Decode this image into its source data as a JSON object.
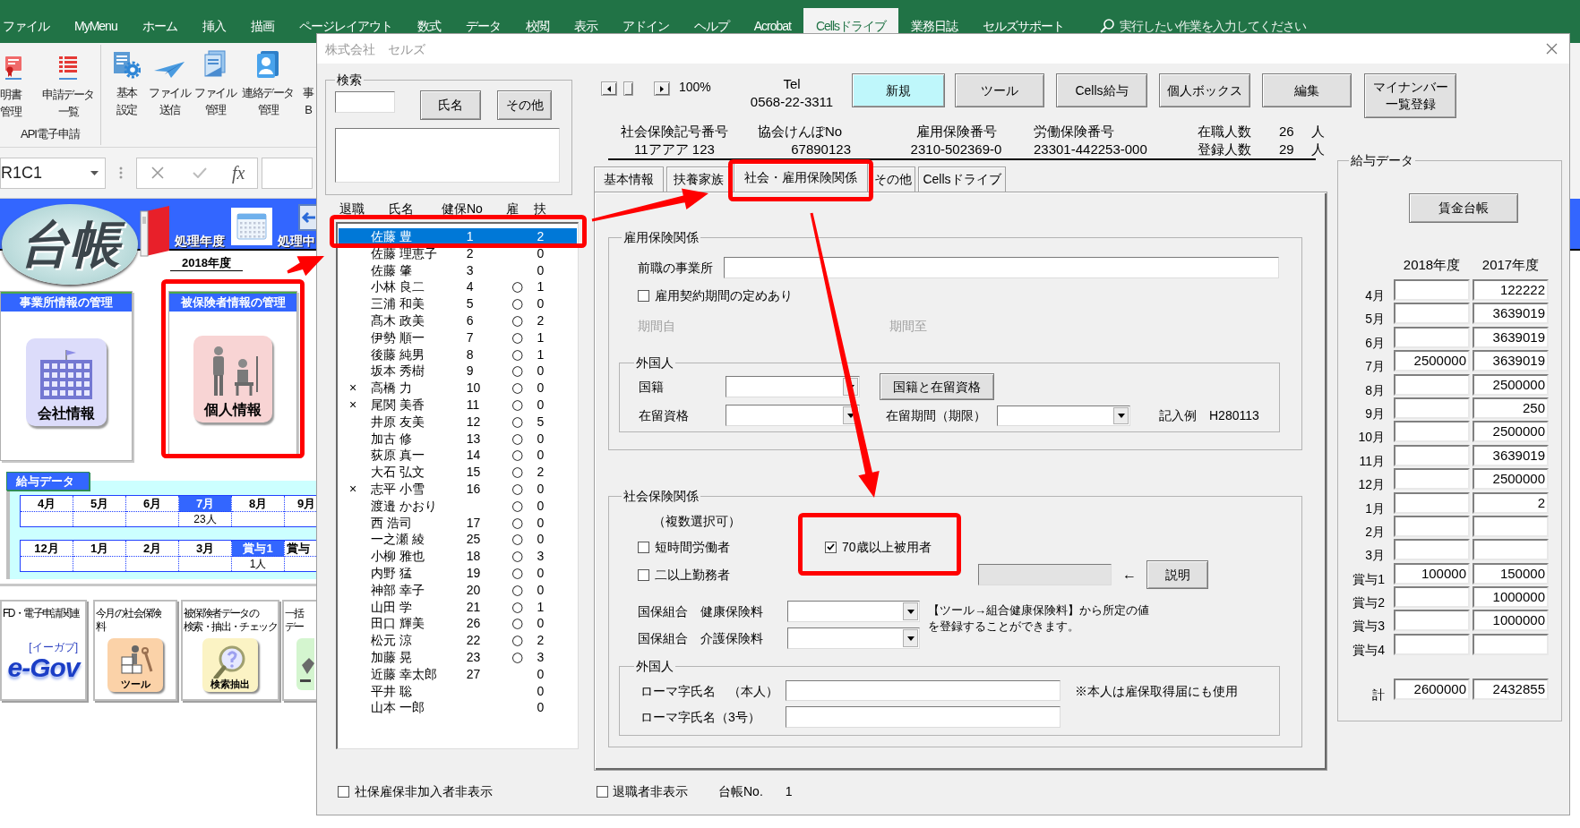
{
  "excel": {
    "ribbon_tabs": [
      {
        "label": "ファイル",
        "selected": false
      },
      {
        "label": "MyMenu",
        "selected": false
      },
      {
        "label": "ホーム",
        "selected": false
      },
      {
        "label": "挿入",
        "selected": false
      },
      {
        "label": "描画",
        "selected": false
      },
      {
        "label": "ページレイアウト",
        "selected": false
      },
      {
        "label": "数式",
        "selected": false
      },
      {
        "label": "データ",
        "selected": false
      },
      {
        "label": "校閲",
        "selected": false
      },
      {
        "label": "表示",
        "selected": false
      },
      {
        "label": "アドイン",
        "selected": false
      },
      {
        "label": "ヘルプ",
        "selected": false
      },
      {
        "label": "Acrobat",
        "selected": false
      },
      {
        "label": "Cellsドライブ",
        "selected": true
      },
      {
        "label": "業務日誌",
        "selected": false
      },
      {
        "label": "セルズサポート",
        "selected": false
      }
    ],
    "tell_me": {
      "placeholder": "実行したい作業を入力してください"
    },
    "ribbon_groups": [
      {
        "label": "API電子申請",
        "buttons": [
          {
            "lines": [
              "明書",
              "管理"
            ]
          },
          {
            "lines": [
              "申請データ",
              "一覧"
            ]
          }
        ]
      },
      {
        "buttons": [
          {
            "lines": [
              "基本",
              "設定"
            ]
          },
          {
            "lines": [
              "ファイル",
              "送信"
            ]
          },
          {
            "lines": [
              "ファイル",
              "管理"
            ]
          },
          {
            "lines": [
              "連絡データ",
              "管理"
            ]
          },
          {
            "lines": [
              "事",
              "B"
            ]
          }
        ]
      }
    ],
    "formula_bar": {
      "name_box": "R1C1",
      "function_label": "fx"
    },
    "sheet": {
      "logo": "台帳",
      "year_label": "処理年度",
      "current_label": "処理中",
      "year_value": "2018年度",
      "cards": [
        {
          "title": "事業所情報の管理",
          "caption": "会社情報"
        },
        {
          "title": "被保険者情報の管理",
          "caption": "個人情報"
        }
      ],
      "salary": {
        "title": "給与データ",
        "rows": [
          [
            {
              "label": "4月",
              "selected": false
            },
            {
              "label": "5月",
              "selected": false
            },
            {
              "label": "6月",
              "selected": false
            },
            {
              "label": "7月",
              "selected": true,
              "count": "23人"
            },
            {
              "label": "8月",
              "selected": false
            },
            {
              "label": "9月",
              "selected": false
            }
          ],
          [
            {
              "label": "12月",
              "selected": false
            },
            {
              "label": "1月",
              "selected": false
            },
            {
              "label": "2月",
              "selected": false
            },
            {
              "label": "3月",
              "selected": false
            },
            {
              "label": "賞与1",
              "selected": true,
              "count": "1人"
            },
            {
              "label": "賞与",
              "selected": false
            }
          ]
        ]
      },
      "shortcuts": [
        {
          "title_lines": [
            "FD・電子申請関連"
          ],
          "logo_caption": "[イーガブ]",
          "logo": "e-Gov"
        },
        {
          "title_lines": [
            "今月の社会保険",
            "料"
          ],
          "caption": "ツール"
        },
        {
          "title_lines": [
            "被保険者データの",
            "検索・抽出・チェック"
          ],
          "caption": "検索抽出"
        },
        {
          "title_lines": [
            "一括",
            "デー"
          ]
        }
      ]
    }
  },
  "dialog": {
    "title": "株式会社　セルズ",
    "search": {
      "title": "検索",
      "buttons": [
        "氏名",
        "その他"
      ]
    },
    "list": {
      "columns": [
        "退職",
        "氏名",
        "健保No",
        "雇",
        "扶"
      ],
      "rows": [
        {
          "selected": true,
          "name": "佐藤 豊",
          "no": "1",
          "dep": "2"
        },
        {
          "selected": false,
          "name": "佐藤 理恵子",
          "no": "2",
          "dep": "0"
        },
        {
          "selected": false,
          "name": "佐藤 肇",
          "no": "3",
          "dep": "0"
        },
        {
          "selected": false,
          "name": "小林 良二",
          "no": "4",
          "emp": "○",
          "dep": "1"
        },
        {
          "selected": false,
          "name": "三浦 和美",
          "no": "5",
          "emp": "○",
          "dep": "0"
        },
        {
          "selected": false,
          "name": "髙木 政美",
          "no": "6",
          "emp": "○",
          "dep": "2"
        },
        {
          "selected": false,
          "name": "伊勢 順一",
          "no": "7",
          "emp": "○",
          "dep": "1"
        },
        {
          "selected": false,
          "name": "後藤 純男",
          "no": "8",
          "emp": "○",
          "dep": "1"
        },
        {
          "selected": false,
          "name": "坂本 秀樹",
          "no": "9",
          "emp": "○",
          "dep": "0"
        },
        {
          "selected": false,
          "retired": "×",
          "name": "高橋 力",
          "no": "10",
          "emp": "○",
          "dep": "0"
        },
        {
          "selected": false,
          "retired": "×",
          "name": "尾関 美香",
          "no": "11",
          "emp": "○",
          "dep": "0"
        },
        {
          "selected": false,
          "name": "井原 友美",
          "no": "12",
          "emp": "○",
          "dep": "5"
        },
        {
          "selected": false,
          "name": "加古 修",
          "no": "13",
          "emp": "○",
          "dep": "0"
        },
        {
          "selected": false,
          "name": "荻原 真一",
          "no": "14",
          "emp": "○",
          "dep": "0"
        },
        {
          "selected": false,
          "name": "大石 弘文",
          "no": "15",
          "emp": "○",
          "dep": "2"
        },
        {
          "selected": false,
          "retired": "×",
          "name": "志平 小雪",
          "no": "16",
          "emp": "○",
          "dep": "0"
        },
        {
          "selected": false,
          "name": "渡邉 かおり",
          "emp": "○",
          "dep": "0"
        },
        {
          "selected": false,
          "name": "西 浩司",
          "no": "17",
          "emp": "○",
          "dep": "0"
        },
        {
          "selected": false,
          "name": "一之瀬 綾",
          "no": "25",
          "emp": "○",
          "dep": "0"
        },
        {
          "selected": false,
          "name": "小柳 雅也",
          "no": "18",
          "emp": "○",
          "dep": "3"
        },
        {
          "selected": false,
          "name": "内野 猛",
          "no": "19",
          "emp": "○",
          "dep": "0"
        },
        {
          "selected": false,
          "name": "神部 幸子",
          "no": "20",
          "emp": "○",
          "dep": "0"
        },
        {
          "selected": false,
          "name": "山田 学",
          "no": "21",
          "emp": "○",
          "dep": "1"
        },
        {
          "selected": false,
          "name": "田口 輝美",
          "no": "26",
          "emp": "○",
          "dep": "0"
        },
        {
          "selected": false,
          "name": "松元 涼",
          "no": "22",
          "emp": "○",
          "dep": "2"
        },
        {
          "selected": false,
          "name": "加藤 晃",
          "no": "23",
          "emp": "○",
          "dep": "3"
        },
        {
          "selected": false,
          "name": "近藤 幸太郎",
          "no": "27",
          "dep": "0"
        },
        {
          "selected": false,
          "name": "平井 聡",
          "dep": "0"
        },
        {
          "selected": false,
          "name": "山本 一郎",
          "dep": "0"
        }
      ]
    },
    "hide_uninsured": {
      "label": "社保雇保非加入者非表示",
      "checked": false
    },
    "zoom": "100%",
    "tel": {
      "label": "Tel",
      "value": "0568-22-3311"
    },
    "toolbar": [
      {
        "label": "新規",
        "highlighted": true
      },
      {
        "label": "ツール",
        "highlighted": false
      },
      {
        "label": "Cells給与",
        "highlighted": false
      },
      {
        "label": "個人ボックス",
        "highlighted": false
      },
      {
        "label": "編集",
        "highlighted": false
      },
      {
        "label": "マイナンバー一覧登録",
        "highlighted": false
      }
    ],
    "info": [
      {
        "label": "社会保険記号番号",
        "value": "11アアア 123"
      },
      {
        "label": "協会けんぽNo",
        "value": "67890123"
      },
      {
        "label": "雇用保険番号",
        "value": "2310-502369-0"
      },
      {
        "label": "労働保険番号",
        "value": "23301-442253-000"
      }
    ],
    "counts": [
      {
        "label": "在職人数",
        "value": "26",
        "unit": "人"
      },
      {
        "label": "登録人数",
        "value": "29",
        "unit": "人"
      }
    ],
    "tabs": [
      {
        "label": "基本情報",
        "selected": false
      },
      {
        "label": "扶養家族",
        "selected": false
      },
      {
        "label": "社会・雇用保険関係",
        "selected": true
      },
      {
        "label": "その他",
        "selected": false
      },
      {
        "label": "Cellsドライブ",
        "selected": false
      }
    ],
    "employment": {
      "title": "雇用保険関係",
      "previous_office": "前職の事業所",
      "contract": {
        "label": "雇用契約期間の定めあり",
        "checked": false
      },
      "period": [
        {
          "label": "期間自",
          "disabled": true
        },
        {
          "label": "期間至",
          "disabled": true
        }
      ],
      "foreign": {
        "title": "外国人",
        "nationality": "国籍",
        "residence_status": "在留資格",
        "status_button": "国籍と在留資格",
        "period_label": "在留期間（期限）",
        "example": "記入例　H280113"
      }
    },
    "social": {
      "title": "社会保険関係",
      "note": "（複数選択可）",
      "checks": [
        {
          "label": "短時間労働者",
          "checked": false
        },
        {
          "label": "70歳以上被用者",
          "checked": true
        },
        {
          "label": "二以上勤務者",
          "checked": false
        }
      ],
      "combined_pay": {
        "disabled": true
      },
      "arrow": "←",
      "explain_button": "説明",
      "union_fees": [
        "国保組合　健康保険料",
        "国保組合　介護保険料"
      ],
      "union_note": "【ツール→組合健康保険料】から所定の値を登録することができます。",
      "foreign": {
        "title": "外国人",
        "fields": [
          "ローマ字氏名　（本人）",
          "ローマ字氏名（3号）"
        ],
        "note": "※本人は雇保取得届にも使用"
      }
    },
    "salary": {
      "title": "給与データ",
      "button": "賃金台帳",
      "years": [
        "2018年度",
        "2017年度"
      ],
      "rows": [
        {
          "label": "4月",
          "fy2017": "122222"
        },
        {
          "label": "5月",
          "fy2017": "3639019"
        },
        {
          "label": "6月",
          "fy2017": "3639019"
        },
        {
          "label": "7月",
          "fy2018": "2500000",
          "fy2017": "3639019"
        },
        {
          "label": "8月",
          "fy2017": "2500000"
        },
        {
          "label": "9月",
          "fy2017": "250"
        },
        {
          "label": "10月",
          "fy2017": "2500000"
        },
        {
          "label": "11月",
          "fy2017": "3639019"
        },
        {
          "label": "12月",
          "fy2017": "2500000"
        },
        {
          "label": "1月",
          "fy2017": "2"
        },
        {
          "label": "2月"
        },
        {
          "label": "3月"
        },
        {
          "label": "賞与1",
          "fy2018": "100000",
          "fy2017": "150000"
        },
        {
          "label": "賞与2",
          "fy2017": "1000000"
        },
        {
          "label": "賞与3",
          "fy2017": "1000000"
        },
        {
          "label": "賞与4"
        }
      ],
      "total": {
        "label": "計",
        "fy2018": "2600000",
        "fy2017": "2432855"
      }
    },
    "hide_retired": {
      "label": "退職者非表示",
      "checked": false
    },
    "ledger_no": {
      "label": "台帳No.",
      "value": "1"
    }
  }
}
